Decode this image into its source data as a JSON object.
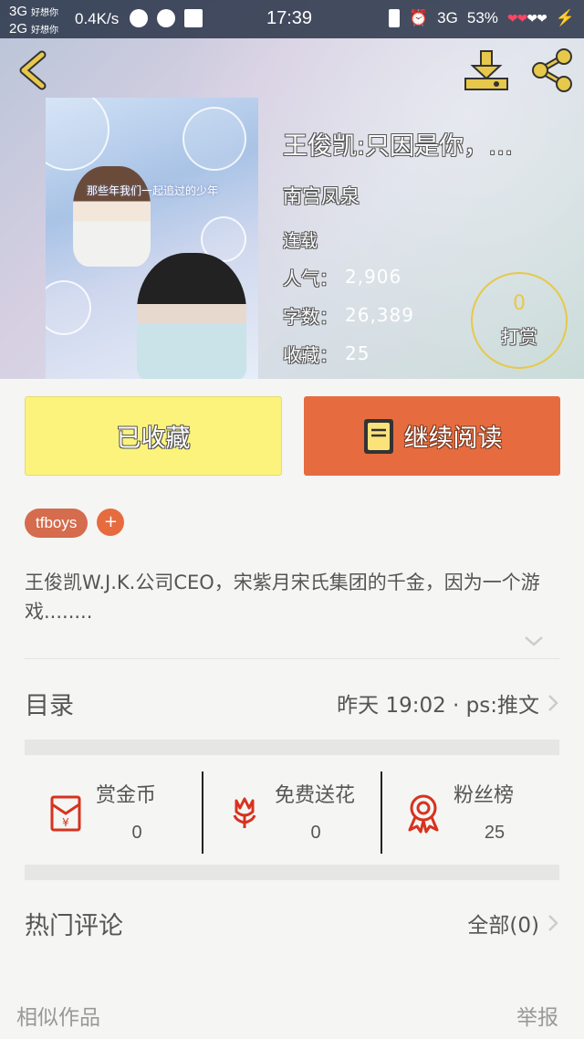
{
  "statusbar": {
    "sim1": "3G",
    "sim1_carrier": "好想你",
    "sim2": "2G",
    "sim2_carrier": "好想你",
    "speed": "0.4K/s",
    "time": "17:39",
    "network": "3G",
    "battery": "53%"
  },
  "book": {
    "title": "王俊凯:只因是你，…",
    "author": "南宫凤泉",
    "status": "连载",
    "popularity_label": "人气",
    "popularity": "2,906",
    "wordcount_label": "字数",
    "wordcount": "26,389",
    "favorites_label": "收藏",
    "favorites": "25",
    "cover_caption": "那些年我们一起追过的少年"
  },
  "tip": {
    "count": "0",
    "label": "打赏"
  },
  "actions": {
    "favorited_label": "已收藏",
    "continue_label": "继续阅读"
  },
  "tags": {
    "items": [
      "tfboys"
    ],
    "add_label": "+"
  },
  "description": "王俊凯W.J.K.公司CEO，宋紫月宋氏集团的千金，因为一个游戏........",
  "toc": {
    "label": "目录",
    "latest": "昨天 19:02 · ps:推文"
  },
  "stats": [
    {
      "label": "赏金币",
      "value": "0",
      "icon": "red-envelope-icon"
    },
    {
      "label": "免费送花",
      "value": "0",
      "icon": "flower-icon"
    },
    {
      "label": "粉丝榜",
      "value": "25",
      "icon": "ribbon-medal-icon"
    }
  ],
  "comments": {
    "label": "热门评论",
    "all_label": "全部(0)"
  },
  "footer": {
    "similar_label": "相似作品",
    "report_label": "举报"
  },
  "colors": {
    "favorite_button": "#fbf37c",
    "continue_button": "#e66c3f",
    "tag": "#d46c4d",
    "tip_ring": "#e7c84a",
    "icon_red": "#d6331f",
    "back_icon": "#e7c84a"
  }
}
